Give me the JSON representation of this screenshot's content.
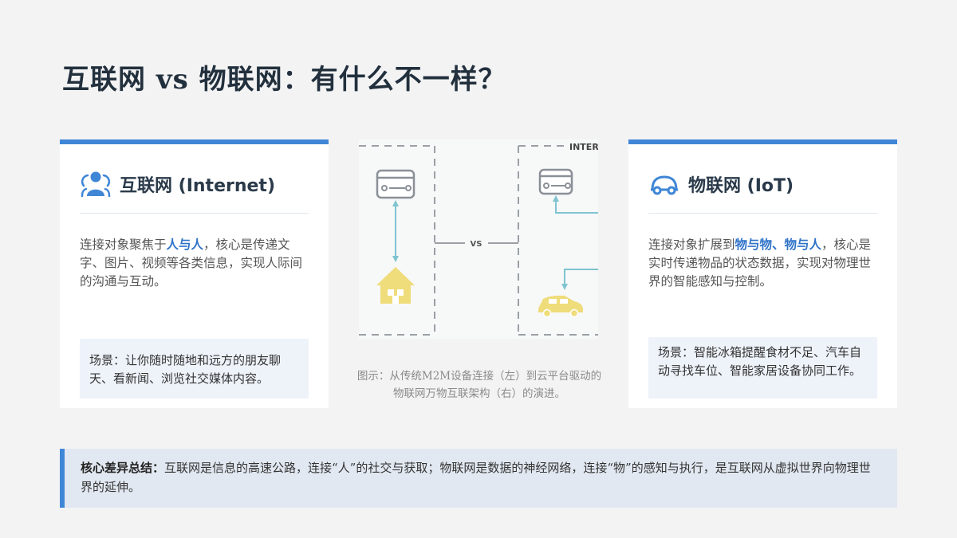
{
  "title": "互联网 vs 物联网：有什么不一样？",
  "internet": {
    "icon": "users-icon",
    "title": "互联网 (Internet)",
    "desc_prefix": "连接对象聚焦于",
    "desc_highlight": "人与人",
    "desc_suffix": "，核心是传递文字、图片、视频等各类信息，实现人际间的沟通与互动。",
    "scene": "场景：让你随时随地和远方的朋友聊天、看新闻、浏览社交媒体内容。"
  },
  "iot": {
    "icon": "car-icon",
    "title": "物联网 (IoT)",
    "desc_prefix": "连接对象扩展到",
    "desc_highlight": "物与物、物与人",
    "desc_suffix": "，核心是实时传递物品的状态数据，实现对物理世界的智能感知与控制。",
    "scene": "场景：智能冰箱提醒食材不足、汽车自动寻找车位、智能家居设备协同工作。"
  },
  "figure": {
    "vs_label": "VS",
    "corner_label": "INTER",
    "caption": "图示：从传统M2M设备连接（左）到云平台驱动的物联网万物互联架构（右）的演进。",
    "accent_color": "#7fc4d0",
    "object_color": "#efdc7a"
  },
  "summary": {
    "label": "核心差异总结：",
    "text": "互联网是信息的高速公路，连接“人”的社交与获取；物联网是数据的神经网络，连接“物”的感知与执行，是互联网从虚拟世界向物理世界的延伸。"
  },
  "colors": {
    "accent": "#3f86d6",
    "highlight": "#2f73c8",
    "scene_bg": "#eef3fa",
    "summary_bg": "#e2e8f1"
  }
}
